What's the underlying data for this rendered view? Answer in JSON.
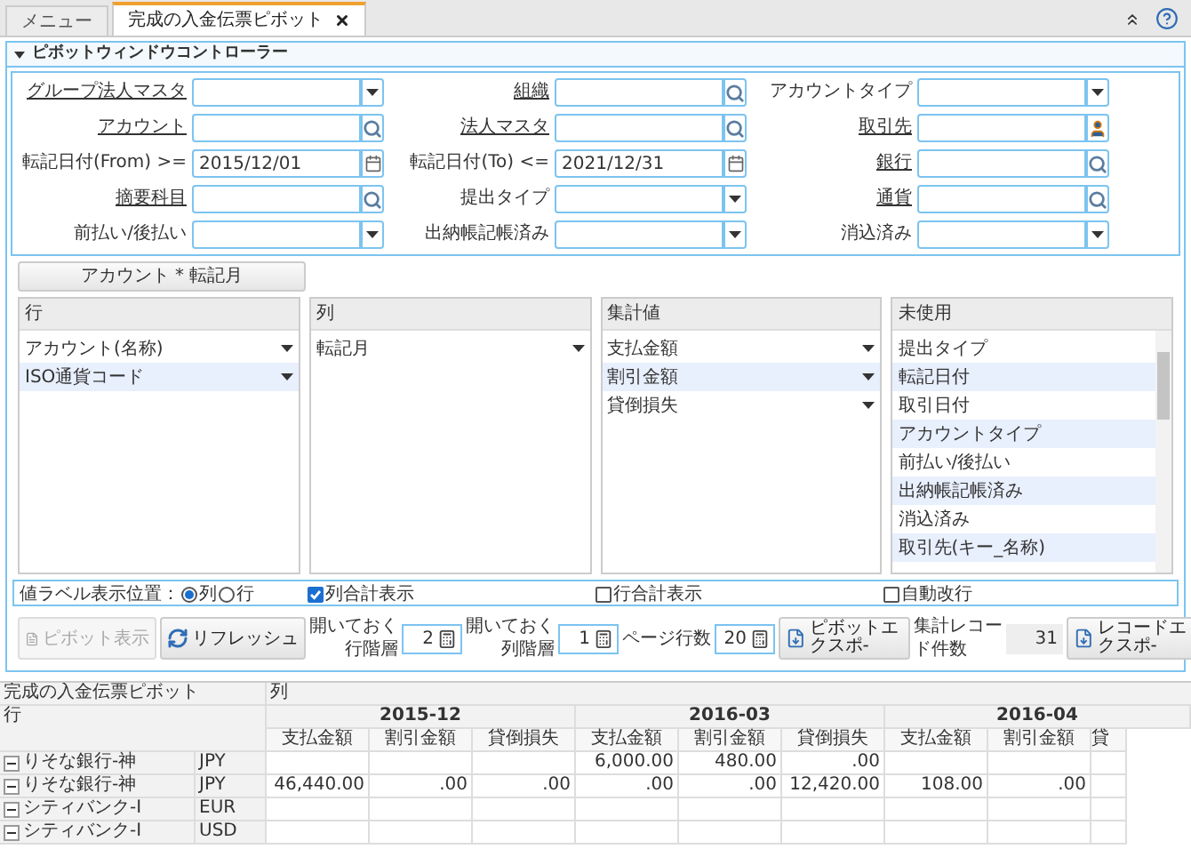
{
  "tabs": [
    {
      "label": "メニュー",
      "selected": false,
      "closable": false
    },
    {
      "label": "完成の入金伝票ピボット",
      "selected": true,
      "closable": true
    }
  ],
  "panel": {
    "title": "ピボットウィンドウコントローラー",
    "expanded": true
  },
  "filters": [
    {
      "label": "グループ法人マスタ",
      "link": true,
      "kind": "select"
    },
    {
      "label": "組織",
      "link": true,
      "kind": "lookup"
    },
    {
      "label": "アカウントタイプ",
      "link": false,
      "kind": "select"
    },
    {
      "label": "アカウント",
      "link": true,
      "kind": "lookup"
    },
    {
      "label": "法人マスタ",
      "link": true,
      "kind": "lookup"
    },
    {
      "label": "取引先",
      "link": true,
      "kind": "person"
    },
    {
      "label": "転記日付(From) >=",
      "link": false,
      "kind": "date",
      "value": "2015/12/01"
    },
    {
      "label": "転記日付(To) <=",
      "link": false,
      "kind": "date",
      "value": "2021/12/31"
    },
    {
      "label": "銀行",
      "link": true,
      "kind": "lookup"
    },
    {
      "label": "摘要科目",
      "link": true,
      "kind": "lookup"
    },
    {
      "label": "提出タイプ",
      "link": false,
      "kind": "select"
    },
    {
      "label": "通貨",
      "link": true,
      "kind": "lookup"
    },
    {
      "label": "前払い/後払い",
      "link": false,
      "kind": "select"
    },
    {
      "label": "出納帳記帳済み",
      "link": false,
      "kind": "select"
    },
    {
      "label": "消込済み",
      "link": false,
      "kind": "select"
    }
  ],
  "layout_button": "アカウント * 転記月",
  "areas": [
    {
      "title": "行",
      "items": [
        {
          "label": "アカウント(名称)",
          "selected": false
        },
        {
          "label": "ISO通貨コード",
          "selected": true
        }
      ]
    },
    {
      "title": "列",
      "items": [
        {
          "label": "転記月",
          "selected": false
        }
      ]
    },
    {
      "title": "集計値",
      "items": [
        {
          "label": "支払金額",
          "selected": false
        },
        {
          "label": "割引金額",
          "selected": true
        },
        {
          "label": "貸倒損失",
          "selected": false
        }
      ]
    },
    {
      "title": "未使用",
      "items": [
        {
          "label": "提出タイプ",
          "selected": false
        },
        {
          "label": "転記日付",
          "selected": true
        },
        {
          "label": "取引日付",
          "selected": false
        },
        {
          "label": "アカウントタイプ",
          "selected": true
        },
        {
          "label": "前払い/後払い",
          "selected": false
        },
        {
          "label": "出納帳記帳済み",
          "selected": true
        },
        {
          "label": "消込済み",
          "selected": false
        },
        {
          "label": "取引先(キー_名称)",
          "selected": true
        }
      ]
    }
  ],
  "options": {
    "label_position": "値ラベル表示位置：",
    "radios": [
      {
        "label": "列",
        "selected": true
      },
      {
        "label": "行",
        "selected": false
      }
    ],
    "checkboxes": [
      {
        "label": "列合計表示",
        "checked": true
      },
      {
        "label": "行合計表示",
        "checked": false
      },
      {
        "label": "自動改行",
        "checked": false
      }
    ]
  },
  "toolbar": [
    {
      "kind": "button",
      "label": "ピボット表示",
      "disabled": true
    },
    {
      "kind": "button",
      "label": "リフレッシュ",
      "disabled": false
    },
    {
      "kind": "spinner",
      "label": "開いておく行階層",
      "value": "2"
    },
    {
      "kind": "spinner",
      "label": "開いておく列階層",
      "value": "1"
    },
    {
      "kind": "spinner",
      "label": "ページ行数",
      "value": "20"
    },
    {
      "kind": "button",
      "label": "ピボットエクスポ-",
      "disabled": false
    },
    {
      "kind": "readout",
      "label": "集計レコード件数",
      "value": "31"
    },
    {
      "kind": "button",
      "label": "レコードエクスポ-",
      "disabled": false
    }
  ],
  "pivot": {
    "title": "完成の入金伝票ピボット",
    "col_header": "列",
    "row_header": "行",
    "periods": [
      "2015-12",
      "2016-03",
      "2016-04"
    ],
    "measures": [
      "支払金額",
      "割引金額",
      "貸倒損失",
      "支払金額",
      "割引金額",
      "貸倒損失",
      "支払金額",
      "割引金額",
      "貸"
    ],
    "rows": [
      {
        "name": "りそな銀行-神",
        "currency": "JPY",
        "expanded": true,
        "cells": [
          "",
          "",
          "",
          "6,000.00",
          "480.00",
          ".00",
          "",
          "",
          ""
        ]
      },
      {
        "name": "りそな銀行-神",
        "currency": "JPY",
        "expanded": true,
        "cells": [
          "46,440.00",
          ".00",
          ".00",
          ".00",
          ".00",
          "12,420.00",
          "108.00",
          ".00",
          ""
        ]
      },
      {
        "name": "シティバンク-I",
        "currency": "EUR",
        "expanded": true,
        "cells": [
          "",
          "",
          "",
          "",
          "",
          "",
          "",
          "",
          ""
        ]
      },
      {
        "name": "シティバンク-I",
        "currency": "USD",
        "expanded": true,
        "cells": [
          "",
          "",
          "",
          "",
          "",
          "",
          "",
          "",
          ""
        ]
      }
    ]
  }
}
